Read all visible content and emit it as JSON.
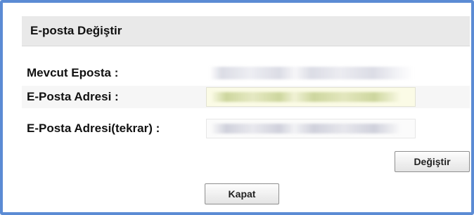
{
  "dialog": {
    "title": "E-posta Değiştir",
    "fields": [
      {
        "label": "Mevcut Eposta :",
        "value": ""
      },
      {
        "label": "E-Posta Adresi :",
        "value": ""
      },
      {
        "label": "E-Posta Adresi(tekrar) :",
        "value": ""
      }
    ],
    "change_button_label": "Değiştir",
    "close_button_label": "Kapat"
  },
  "colors": {
    "frame_border": "#5b8bd4",
    "header_background": "#e9e9e9",
    "autofill_background": "#fbfbe6"
  }
}
